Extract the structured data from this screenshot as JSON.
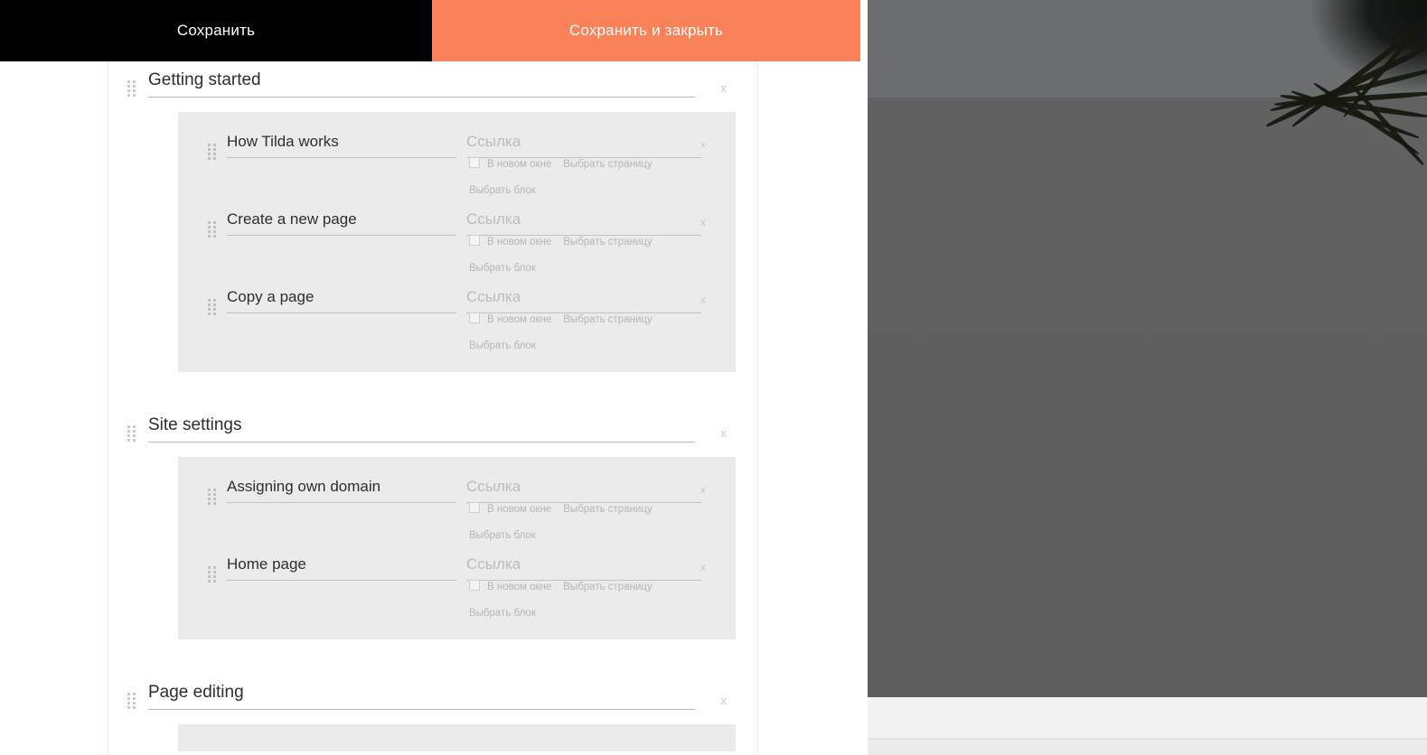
{
  "action_bar": {
    "save_label": "Сохранить",
    "save_and_close_label": "Сохранить и закрыть",
    "save_bg": "#000000",
    "save_close_bg": "#fa8258"
  },
  "labels": {
    "link_placeholder": "Ссылка",
    "new_window": "В новом окне",
    "choose_page": "Выбрать страницу",
    "choose_block": "Выбрать блок",
    "delete": "x"
  },
  "menu": {
    "sections": [
      {
        "title": "Getting started",
        "items": [
          {
            "title": "How Tilda works",
            "link": "",
            "new_window": false
          },
          {
            "title": "Create a new page",
            "link": "",
            "new_window": false
          },
          {
            "title": "Copy a page",
            "link": "",
            "new_window": false
          }
        ]
      },
      {
        "title": "Site settings",
        "items": [
          {
            "title": "Assigning own domain",
            "link": "",
            "new_window": false
          },
          {
            "title": "Home page",
            "link": "",
            "new_window": false
          }
        ]
      },
      {
        "title": "Page editing",
        "items": []
      }
    ]
  }
}
